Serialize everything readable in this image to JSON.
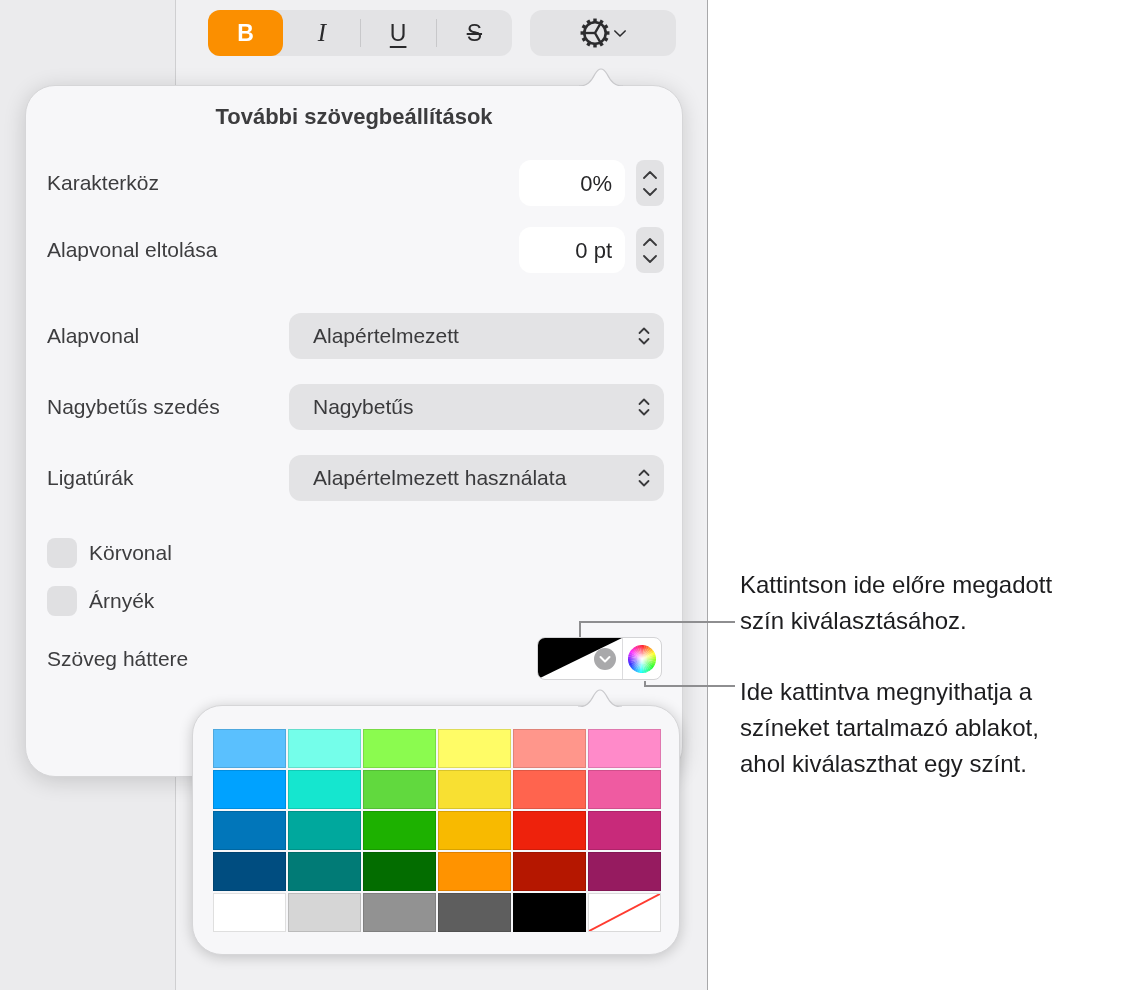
{
  "toolbar": {
    "style_buttons": [
      {
        "label": "B",
        "kind": "bold",
        "selected": true
      },
      {
        "label": "I",
        "kind": "italic",
        "selected": false
      },
      {
        "label": "U",
        "kind": "underline",
        "selected": false
      },
      {
        "label": "S",
        "kind": "strikethrough",
        "selected": false
      }
    ]
  },
  "popover": {
    "title": "További szövegbeállítások",
    "steppers": [
      {
        "label": "Karakterköz",
        "value": "0%"
      },
      {
        "label": "Alapvonal eltolása",
        "value": "0 pt"
      }
    ],
    "popups": [
      {
        "label": "Alapvonal",
        "value": "Alapértelmezett"
      },
      {
        "label": "Nagybetűs szedés",
        "value": "Nagybetűs"
      },
      {
        "label": "Ligatúrák",
        "value": "Alapértelmezett használata"
      }
    ],
    "checkboxes": [
      {
        "label": "Körvonal",
        "checked": false
      },
      {
        "label": "Árnyék",
        "checked": false
      }
    ],
    "text_background": {
      "label": "Szöveg háttere"
    }
  },
  "palette": {
    "swatches": [
      {
        "kind": "color",
        "color": "#5ac0fe"
      },
      {
        "kind": "color",
        "color": "#74feea"
      },
      {
        "kind": "color",
        "color": "#8bfb4f"
      },
      {
        "kind": "color",
        "color": "#fffc66"
      },
      {
        "kind": "color",
        "color": "#ff968b"
      },
      {
        "kind": "color",
        "color": "#ff8ac9"
      },
      {
        "kind": "color",
        "color": "#00a2ff"
      },
      {
        "kind": "color",
        "color": "#15e6cf"
      },
      {
        "kind": "color",
        "color": "#61d93e"
      },
      {
        "kind": "color",
        "color": "#f8e032"
      },
      {
        "kind": "color",
        "color": "#ff644e"
      },
      {
        "kind": "color",
        "color": "#ef5ba1"
      },
      {
        "kind": "color",
        "color": "#0176ba"
      },
      {
        "kind": "color",
        "color": "#00a89d"
      },
      {
        "kind": "color",
        "color": "#1db100"
      },
      {
        "kind": "color",
        "color": "#f8ba00"
      },
      {
        "kind": "color",
        "color": "#ee220c"
      },
      {
        "kind": "color",
        "color": "#c82a7a"
      },
      {
        "kind": "color",
        "color": "#004d80"
      },
      {
        "kind": "color",
        "color": "#017b76"
      },
      {
        "kind": "color",
        "color": "#036d00"
      },
      {
        "kind": "color",
        "color": "#ff9300"
      },
      {
        "kind": "color",
        "color": "#b51700"
      },
      {
        "kind": "color",
        "color": "#961b60"
      },
      {
        "kind": "color",
        "color": "#ffffff"
      },
      {
        "kind": "color",
        "color": "#d6d6d6"
      },
      {
        "kind": "color",
        "color": "#929292"
      },
      {
        "kind": "color",
        "color": "#5e5e5e"
      },
      {
        "kind": "color",
        "color": "#000000"
      },
      {
        "kind": "none"
      }
    ]
  },
  "callouts": [
    {
      "lines": [
        "Kattintson ide előre megadott",
        "szín kiválasztásához."
      ]
    },
    {
      "lines": [
        "Ide kattintva megnyithatja a",
        "színeket tartalmazó ablakot,",
        "ahol kiválaszthat egy színt."
      ]
    }
  ]
}
